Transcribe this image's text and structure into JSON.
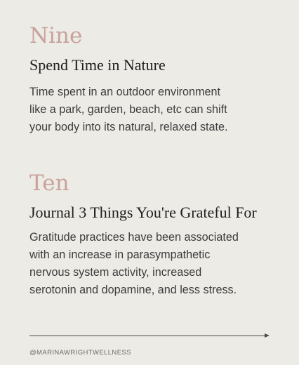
{
  "colors": {
    "background": "#ecebe6",
    "accent_number": "#c9a29b",
    "heading": "#1e1e1e",
    "body_text": "#3c3c3c"
  },
  "tips": [
    {
      "number": "Nine",
      "heading": "Spend Time in Nature",
      "body_lines": [
        "Time spent in an outdoor environment",
        "like a park, garden, beach, etc can shift",
        "your body into its natural, relaxed state."
      ]
    },
    {
      "number": "Ten",
      "heading": "Journal 3 Things You're Grateful For",
      "body_lines": [
        "Gratitude practices have been associated",
        "with an increase in parasympathetic",
        "nervous system activity, increased",
        "serotonin and dopamine, and less stress."
      ]
    }
  ],
  "footer": {
    "arrow_icon": "arrow-right-icon",
    "handle": "@MARINAWRIGHTWELLNESS"
  }
}
